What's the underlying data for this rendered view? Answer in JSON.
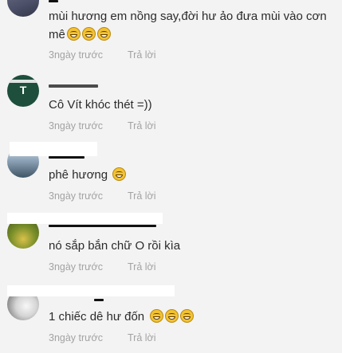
{
  "comments": [
    {
      "text": "mùi hương em nồng say,đời hư ảo đưa mùi vào cơn",
      "text2": "mê",
      "emoji_count": 3,
      "time": "3ngày trước",
      "reply": "Trả lời"
    },
    {
      "avatar_initial": "T",
      "text": "Cô Vít khóc thét =))",
      "time": "3ngày trước",
      "reply": "Trả lời"
    },
    {
      "text": "phê hương",
      "emoji_count": 1,
      "time": "3ngày trước",
      "reply": "Trả lời"
    },
    {
      "text": "nó sắp bắn chữ O rồi kìa",
      "time": "3ngày trước",
      "reply": "Trả lời"
    },
    {
      "text": "1 chiếc dê hư đốn",
      "emoji_count": 3,
      "time": "3ngày trước",
      "reply": "Trả lời"
    }
  ],
  "colors": {
    "background": "#f3f3f3",
    "meta_text": "#a3a3a3",
    "avatar_green": "#1d4f3c"
  }
}
